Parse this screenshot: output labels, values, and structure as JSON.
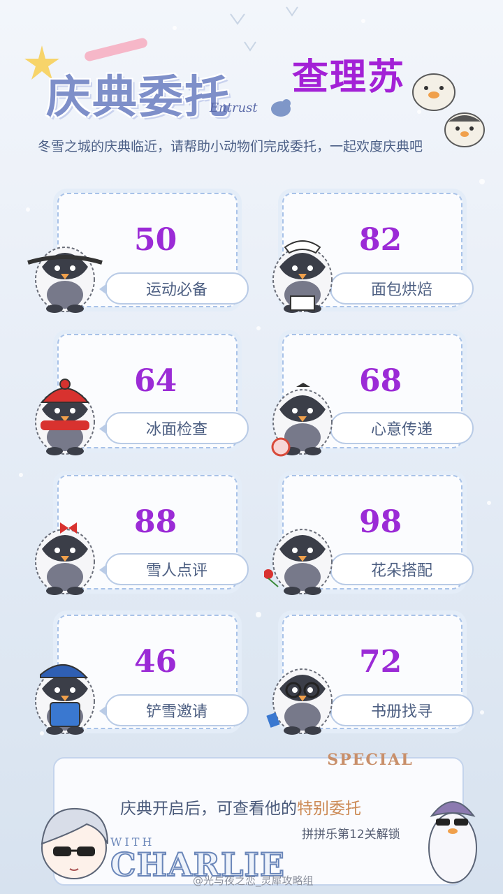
{
  "header": {
    "logo_title": "庆典委托",
    "logo_subtitle": "Entrust",
    "character_name": "查理苏"
  },
  "intro": "冬雪之城的庆典临近，请帮助小动物们完成委托，一起欢度庆典吧",
  "commissions": [
    {
      "number": "50",
      "label": "运动必备",
      "costume": "headband"
    },
    {
      "number": "82",
      "label": "面包烘焙",
      "costume": "maid"
    },
    {
      "number": "64",
      "label": "冰面检查",
      "costume": "red-hat-scarf"
    },
    {
      "number": "68",
      "label": "心意传递",
      "costume": "lollipop"
    },
    {
      "number": "88",
      "label": "雪人点评",
      "costume": "red-bow"
    },
    {
      "number": "98",
      "label": "花朵搭配",
      "costume": "rose"
    },
    {
      "number": "46",
      "label": "铲雪邀请",
      "costume": "overalls"
    },
    {
      "number": "72",
      "label": "书册找寻",
      "costume": "glasses"
    }
  ],
  "special": {
    "tag": "SPECIAL",
    "text_before": "庆典开启后，可查看他的",
    "text_highlight": "特别委托",
    "unlock": "拼拼乐第12关解锁",
    "with": "WITH",
    "charlie": "CHARLIE"
  },
  "watermark": "@光与夜之恋_灵犀攻略组",
  "colors": {
    "accent_purple": "#9b2bd6",
    "name_purple": "#a321d6",
    "highlight_orange": "#cc8a55",
    "card_border": "#a8c2e8"
  }
}
